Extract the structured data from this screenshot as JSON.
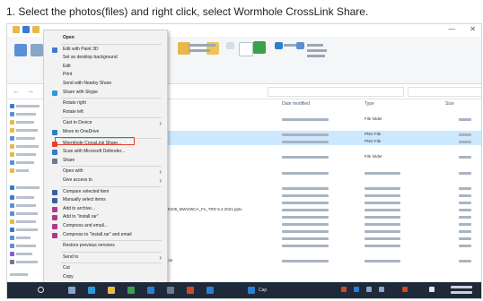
{
  "caption": "1. Select the photos(files) and right click, select Wormhole CrossLink Share.",
  "colors": {
    "highlight_border": "#e8402a",
    "selection": "#cce8ff",
    "taskbar": "#1e2a3a",
    "folder": "#e8b84a",
    "ribbon": "#f5f6f7"
  },
  "context_menu": {
    "items": [
      {
        "label": "Open",
        "bold": true,
        "icon": "",
        "submenu": false
      },
      {
        "label": "Edit with Paint 3D",
        "icon": "paint3d-icon",
        "submenu": false
      },
      {
        "label": "Set as desktop background",
        "icon": "",
        "submenu": false
      },
      {
        "label": "Edit",
        "icon": "",
        "submenu": false
      },
      {
        "label": "Print",
        "icon": "",
        "submenu": false
      },
      {
        "label": "Send with Nearby Share",
        "icon": "",
        "submenu": false
      },
      {
        "label": "Share with Skype",
        "icon": "skype-icon",
        "submenu": false
      },
      {
        "label": "Rotate right",
        "icon": "",
        "submenu": false
      },
      {
        "label": "Rotate left",
        "icon": "",
        "submenu": false
      },
      {
        "label": "Cast to Device",
        "icon": "",
        "submenu": true
      },
      {
        "label": "Move to OneDrive",
        "icon": "onedrive-icon",
        "submenu": false
      },
      {
        "label": "Wormhole CrossLink Share...",
        "icon": "wormhole-icon",
        "submenu": false
      },
      {
        "label": "Scan with Microsoft Defender...",
        "icon": "defender-icon",
        "submenu": false
      },
      {
        "label": "Share",
        "icon": "share-icon",
        "submenu": false
      },
      {
        "label": "Open with",
        "icon": "",
        "submenu": true
      },
      {
        "label": "Give access to",
        "icon": "",
        "submenu": true
      },
      {
        "label": "Compare selected item",
        "icon": "compare-icon",
        "submenu": false
      },
      {
        "label": "Manually select items",
        "icon": "compare-icon",
        "submenu": false
      },
      {
        "label": "Add to archive...",
        "icon": "archive-icon",
        "submenu": false
      },
      {
        "label": "Add to \"install.rar\"",
        "icon": "archive-icon",
        "submenu": false
      },
      {
        "label": "Compress and email...",
        "icon": "archive-icon",
        "submenu": false
      },
      {
        "label": "Compress to \"install.rar\" and email",
        "icon": "archive-icon",
        "submenu": false
      },
      {
        "label": "Restore previous versions",
        "icon": "",
        "submenu": false
      },
      {
        "label": "Send to",
        "icon": "",
        "submenu": true
      },
      {
        "label": "Cut",
        "icon": "",
        "submenu": false
      },
      {
        "label": "Copy",
        "icon": "",
        "submenu": false
      },
      {
        "label": "Create shortcut",
        "icon": "",
        "submenu": false
      },
      {
        "label": "Delete",
        "icon": "",
        "submenu": false
      },
      {
        "label": "Rename",
        "icon": "",
        "submenu": false
      }
    ]
  },
  "file_list": {
    "columns": [
      "Date modified",
      "Type",
      "Size"
    ],
    "rows": [
      {
        "name": "",
        "type": "File folder",
        "selected": false
      },
      {
        "name": "",
        "type": "PNG File",
        "selected": true
      },
      {
        "name": "",
        "type": "PNG File",
        "selected": true
      },
      {
        "name": "",
        "type": "File folder",
        "selected": false
      },
      {
        "name": "",
        "type": "",
        "selected": false
      },
      {
        "name": "...1.2023.pdf",
        "type": "",
        "selected": false
      },
      {
        "name": "...1.2023 (2).pdf",
        "type": "",
        "selected": false
      },
      {
        "name": "...1.2023(1).pdf",
        "type": "",
        "selected": false
      },
      {
        "name": "...MT75_MW100_MW105_MW105CA_Fe_TRD 5.4.2021.pptx",
        "type": "",
        "selected": false
      },
      {
        "name": "",
        "type": "",
        "selected": false
      },
      {
        "name": "...230730.jpg.pdf",
        "type": "",
        "selected": false
      },
      {
        "name": "...pdf",
        "type": "",
        "selected": false
      },
      {
        "name": "",
        "type": "",
        "selected": false
      },
      {
        "name": "",
        "type": "",
        "selected": false
      },
      {
        "name": "...1.2.1.0_F-release.bin",
        "type": "",
        "selected": false
      }
    ]
  },
  "taskbar": {
    "app_label": "Cap"
  }
}
